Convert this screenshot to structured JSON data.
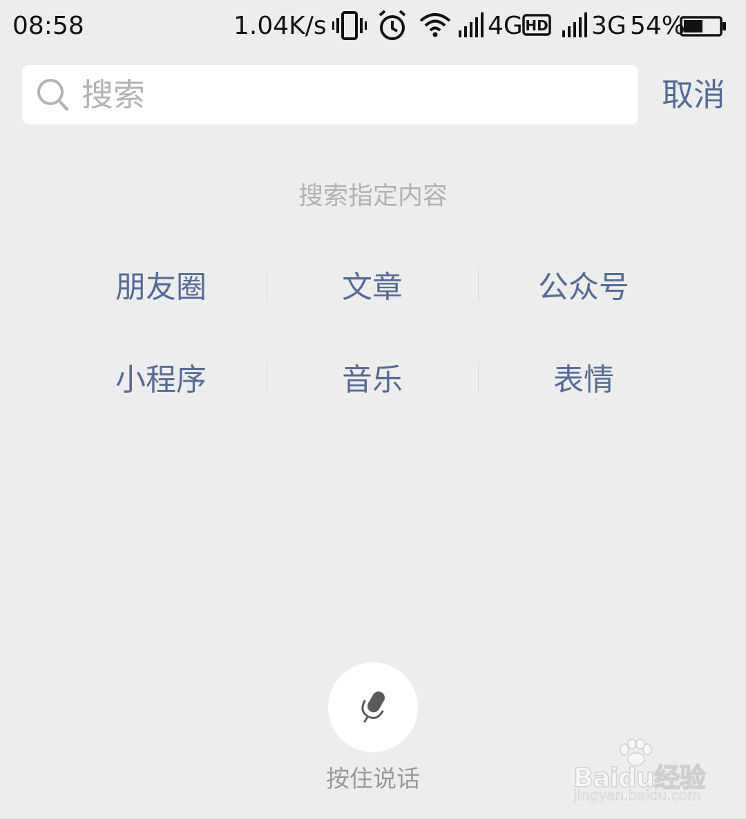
{
  "status_bar": {
    "time": "08:58",
    "network_speed": "1.04K/s",
    "signal1_label": "4G",
    "hd_badge": "HD",
    "signal2_label": "3G",
    "battery_percent": "54%",
    "battery_level": 0.54
  },
  "search": {
    "placeholder": "搜索",
    "value": "",
    "cancel_label": "取消"
  },
  "hint": "搜索指定内容",
  "categories": [
    {
      "label": "朋友圈"
    },
    {
      "label": "文章"
    },
    {
      "label": "公众号"
    },
    {
      "label": "小程序"
    },
    {
      "label": "音乐"
    },
    {
      "label": "表情"
    }
  ],
  "voice": {
    "label": "按住说话"
  },
  "watermark": {
    "brand": "Baidu经验",
    "url": "jingyan.baidu.com"
  }
}
